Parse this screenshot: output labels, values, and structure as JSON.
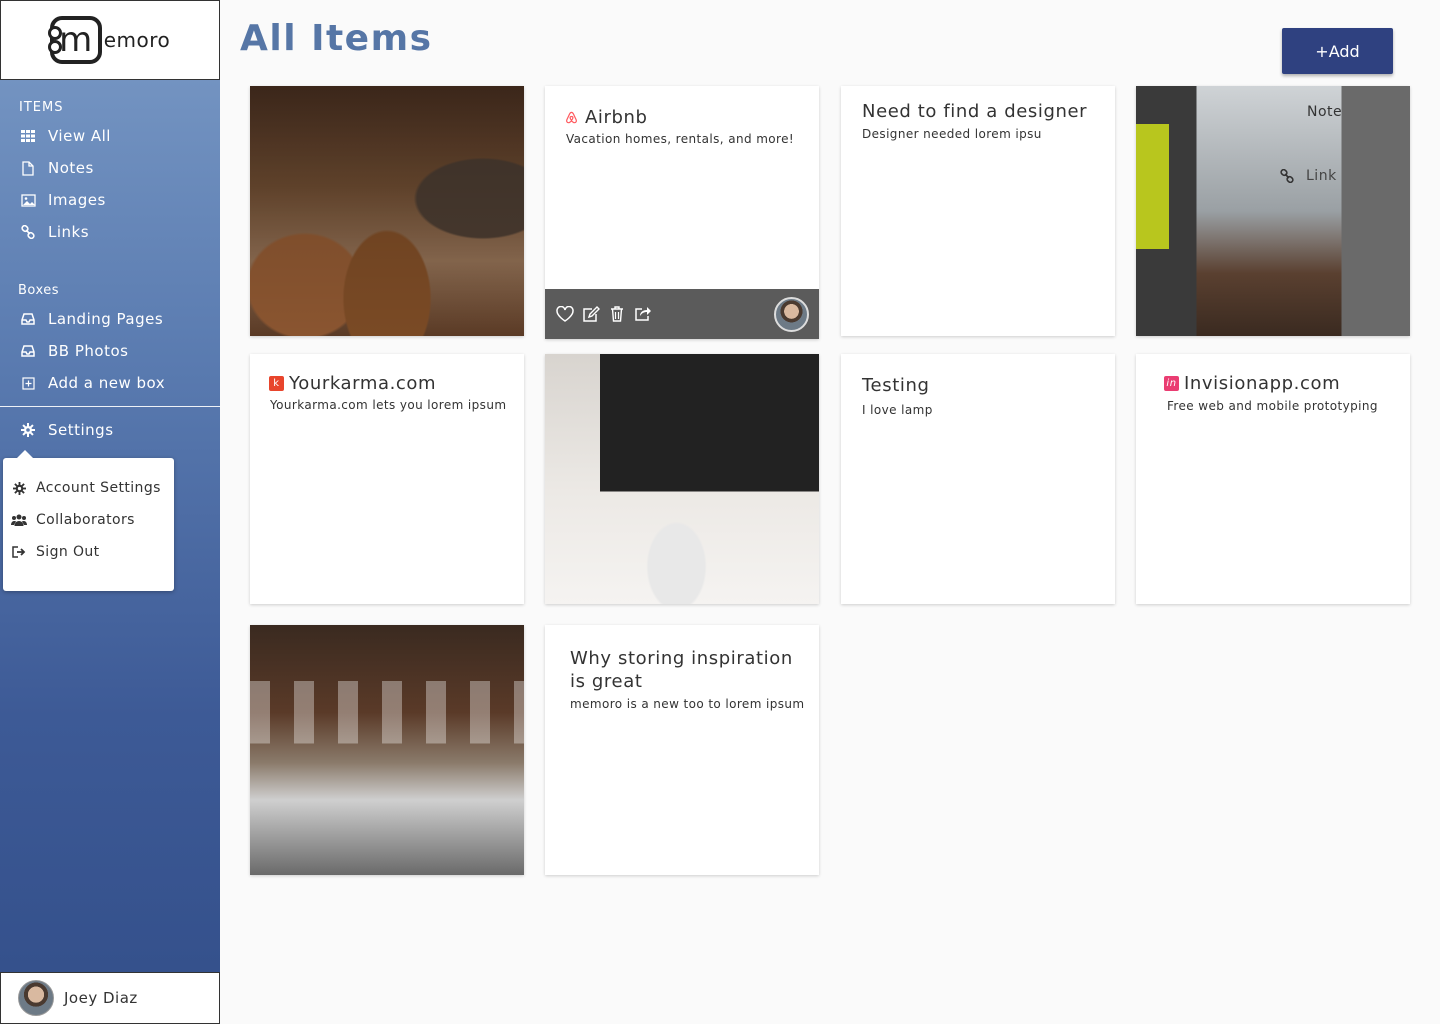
{
  "app": {
    "logo_letter": "m",
    "logo_text": "emoro"
  },
  "sidebar": {
    "items_label": "ITEMS",
    "items": [
      {
        "label": "View All",
        "icon": "grid-icon"
      },
      {
        "label": "Notes",
        "icon": "file-icon"
      },
      {
        "label": "Images",
        "icon": "image-icon"
      },
      {
        "label": "Links",
        "icon": "link-icon"
      }
    ],
    "boxes_label": "Boxes",
    "boxes": [
      {
        "label": "Landing Pages",
        "icon": "inbox-icon"
      },
      {
        "label": "BB Photos",
        "icon": "inbox-icon"
      },
      {
        "label": "Add a new box",
        "icon": "plus-square-icon"
      }
    ],
    "settings_label": "Settings",
    "dropdown": [
      {
        "label": "Account Settings",
        "icon": "gear-icon"
      },
      {
        "label": "Collaborators",
        "icon": "users-icon"
      },
      {
        "label": "Sign Out",
        "icon": "sign-out-icon"
      }
    ],
    "user_name": "Joey Diaz"
  },
  "header": {
    "title": "All Items",
    "add_label": "+Add"
  },
  "cards": {
    "airbnb": {
      "title": "Airbnb",
      "desc": "Vacation homes, rentals, and more!"
    },
    "designer": {
      "title": "Need to find a designer",
      "desc": "Designer needed lorem ipsu"
    },
    "yourkarma": {
      "title": "Yourkarma.com",
      "desc": "Yourkarma.com lets you lorem ipsum"
    },
    "testing": {
      "title": "Testing",
      "desc": "I love lamp"
    },
    "invision": {
      "title": "Invisionapp.com",
      "desc": "Free web and mobile prototyping"
    },
    "inspiration": {
      "title": "Why storing inspiration is great",
      "desc": "memoro is a new too to lorem ipsum"
    }
  },
  "overlay_menu": {
    "note": "Note",
    "link": "Link"
  },
  "colors": {
    "accent": "#2f4180",
    "title": "#5676a6",
    "airbnb": "#ff5a5f",
    "karma": "#e8452c",
    "invision": "#ea3d72"
  }
}
